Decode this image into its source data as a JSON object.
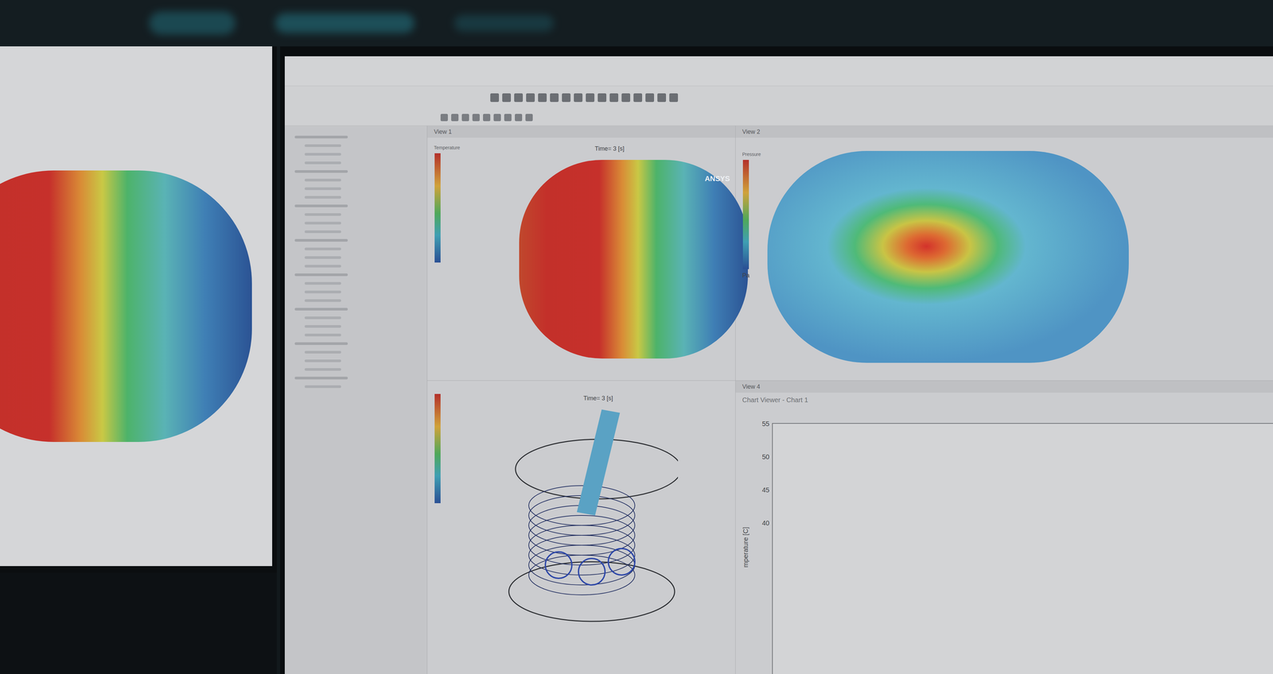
{
  "views": {
    "temperature": {
      "title": "View 1",
      "time": "Time= 3 [s]",
      "logo": "ANSYS",
      "legend_title": "Temperature"
    },
    "pressure": {
      "title": "View 2",
      "legend_title": "Pressure",
      "unit": "Pa"
    },
    "particles": {
      "time": "Time= 3 [s]"
    },
    "chart": {
      "title": "View 4",
      "viewer": "Chart Viewer - Chart 1",
      "y_label": "mperature [C]",
      "y_ticks": [
        "55",
        "50",
        "45",
        "40"
      ]
    }
  }
}
